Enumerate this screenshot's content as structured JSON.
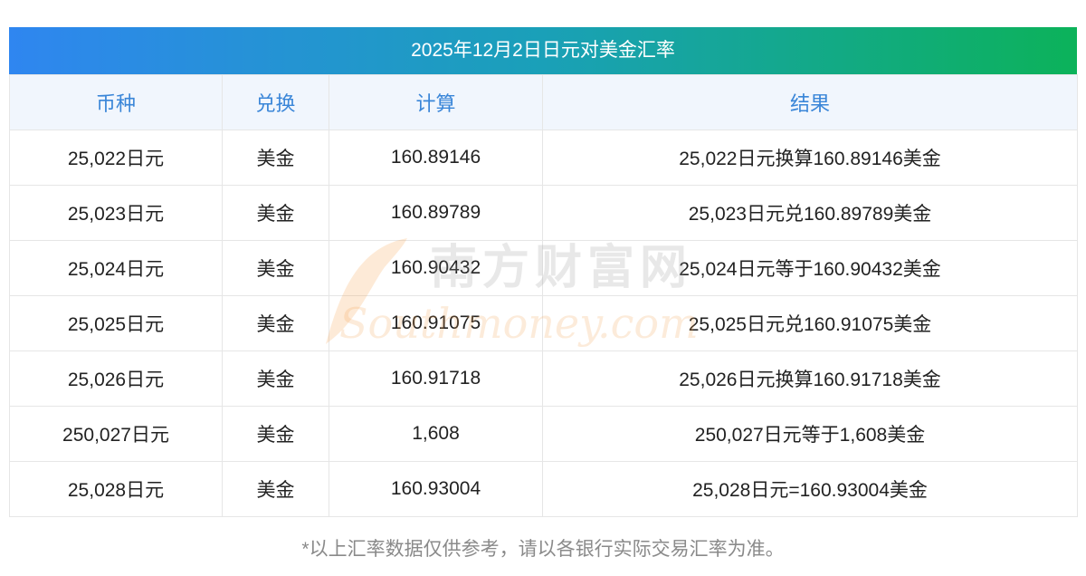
{
  "title": "2025年12月2日日元对美金汇率",
  "columns": [
    "币种",
    "兑换",
    "计算",
    "结果"
  ],
  "rows": [
    {
      "currency": "25,022日元",
      "target": "美金",
      "calc": "160.89146",
      "result": "25,022日元换算160.89146美金"
    },
    {
      "currency": "25,023日元",
      "target": "美金",
      "calc": "160.89789",
      "result": "25,023日元兑160.89789美金"
    },
    {
      "currency": "25,024日元",
      "target": "美金",
      "calc": "160.90432",
      "result": "25,024日元等于160.90432美金"
    },
    {
      "currency": "25,025日元",
      "target": "美金",
      "calc": "160.91075",
      "result": "25,025日元兑160.91075美金"
    },
    {
      "currency": "25,026日元",
      "target": "美金",
      "calc": "160.91718",
      "result": "25,026日元换算160.91718美金"
    },
    {
      "currency": "250,027日元",
      "target": "美金",
      "calc": "1,608",
      "result": "250,027日元等于1,608美金"
    },
    {
      "currency": "25,028日元",
      "target": "美金",
      "calc": "160.93004",
      "result": "25,028日元=160.93004美金"
    }
  ],
  "footnote": "*以上汇率数据仅供参考，请以各银行实际交易汇率为准。",
  "watermark": {
    "brand": "南方财富网",
    "domain": "Southmoney.com"
  },
  "colors": {
    "gradient_start": "#2f86f0",
    "gradient_end": "#0cb25a",
    "header_text": "#3a86d8",
    "header_bg": "#f1f6fd",
    "watermark_orange": "#f5a04a"
  }
}
